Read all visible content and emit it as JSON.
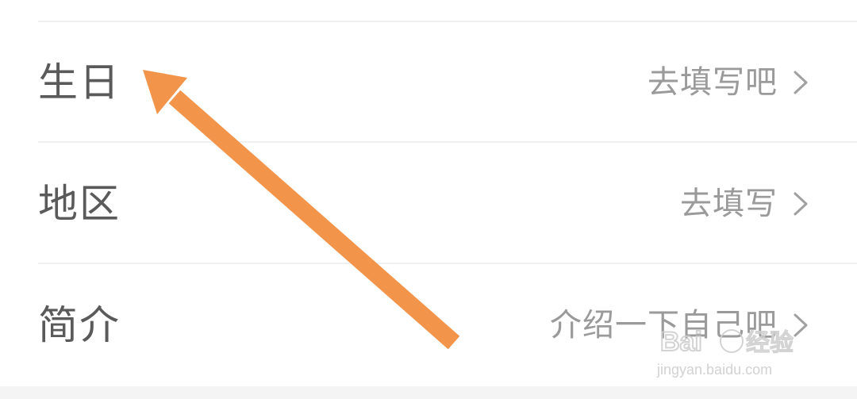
{
  "rows": [
    {
      "label": "生日",
      "value": "去填写吧"
    },
    {
      "label": "地区",
      "value": "去填写"
    },
    {
      "label": "简介",
      "value": "介绍一下自己吧"
    }
  ],
  "icons": {
    "chevron": "chevron-right-icon",
    "annotation": "arrow-annotation-icon"
  },
  "colors": {
    "label": "#5a5a5a",
    "value": "#9a9a9a",
    "divider": "#f0f0f0",
    "arrow": "#f2944a"
  },
  "watermark": {
    "brand": "Baidu经验",
    "url": "jingyan.baidu.com"
  }
}
